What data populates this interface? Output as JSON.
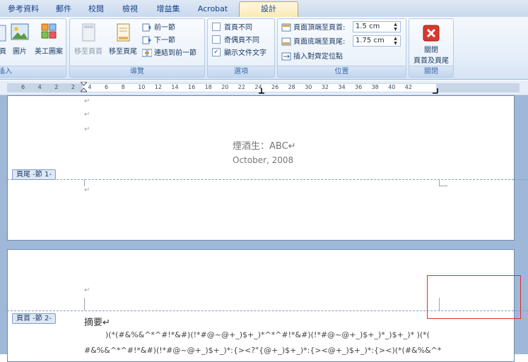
{
  "tabs": [
    "參考資料",
    "郵件",
    "校閱",
    "檢視",
    "增益集",
    "Acrobat",
    "設計"
  ],
  "active_tab": "設計",
  "groups": {
    "insert": {
      "label": "插入",
      "buttons": {
        "header_fragment": "頁",
        "picture": "圖片",
        "clipart": "美工圖案"
      }
    },
    "navigation": {
      "label": "導覽",
      "goto_header": "移至頁首",
      "goto_footer": "移至頁尾",
      "previous_section": "前一節",
      "next_section": "下一節",
      "link_to_previous": "連結到前一節"
    },
    "options": {
      "label": "選項",
      "different_first_page": "首頁不同",
      "different_odd_even": "奇偶頁不同",
      "show_document_text": "顯示文件文字",
      "show_document_text_checked": true
    },
    "position": {
      "label": "位置",
      "header_from_top_label": "頁面頂端至頁首:",
      "header_from_top_value": "1.5 cm",
      "footer_from_bottom_label": "頁面底端至頁尾:",
      "footer_from_bottom_value": "1.75 cm",
      "insert_alignment_tab": "插入對齊定位點"
    },
    "close": {
      "label": "關閉",
      "close_button_line1": "關閉",
      "close_button_line2": "頁首及頁尾"
    }
  },
  "ruler": {
    "labels": [
      "6",
      "4",
      "2",
      "2",
      "4",
      "6",
      "8",
      "10",
      "12",
      "14",
      "16",
      "18",
      "20",
      "22",
      "24",
      "26",
      "28",
      "30",
      "32",
      "34",
      "36",
      "38",
      "40",
      "42"
    ]
  },
  "document": {
    "paragraph_mark": "↵",
    "page1": {
      "center_line1": "煙酒生：ABC↵",
      "center_line2": "October, 2008",
      "footer_tag": "頁尾 -節 1-"
    },
    "page2": {
      "header_tag": "頁首 -節 2-",
      "heading": "摘要↵",
      "body_line1": ")(*(#&%&^*^#!*&#)(!*#@~@+_)$+_)*^*^#!*&#)(!*#@~@+_)$+_)*_)$+_)* )(*(",
      "body_line2": "#&%&^*^#!*&#)(!*#@~@+_)$+_)*:{><?\"{@+_)$+_)*:{><@+_)$+_)*:{><)(*(#&%&^*"
    }
  },
  "colors": {
    "ribbon_tab_active": "#fbe9b3",
    "workspace": "#9fb8d8",
    "highlight_box": "#d9312b"
  }
}
